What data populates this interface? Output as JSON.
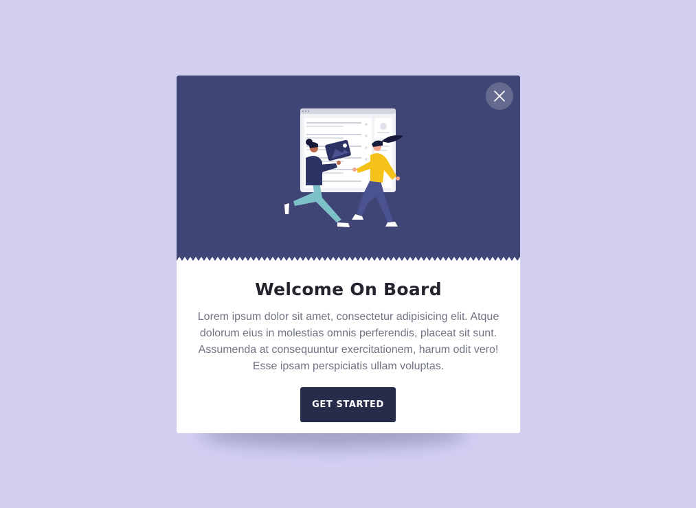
{
  "modal": {
    "title": "Welcome On Board",
    "body": "Lorem ipsum dolor sit amet, consectetur adipisicing elit. Atque dolorum eius in molestias omnis perferendis, placeat sit sunt. Assumenda at consequuntur exercitationem, harum odit vero! Esse ipsam perspiciatis ullam voluptas.",
    "cta_label": "GET STARTED",
    "close_icon": "close-icon",
    "illustration": "two-people-carrying-photo-card-illustration"
  },
  "colors": {
    "page_background": "#d2cff1",
    "hero_background": "#3f4574",
    "button_background": "#272c4a",
    "title_text": "#24242e",
    "body_text": "#6f7383",
    "accent_yellow": "#f5c219"
  }
}
